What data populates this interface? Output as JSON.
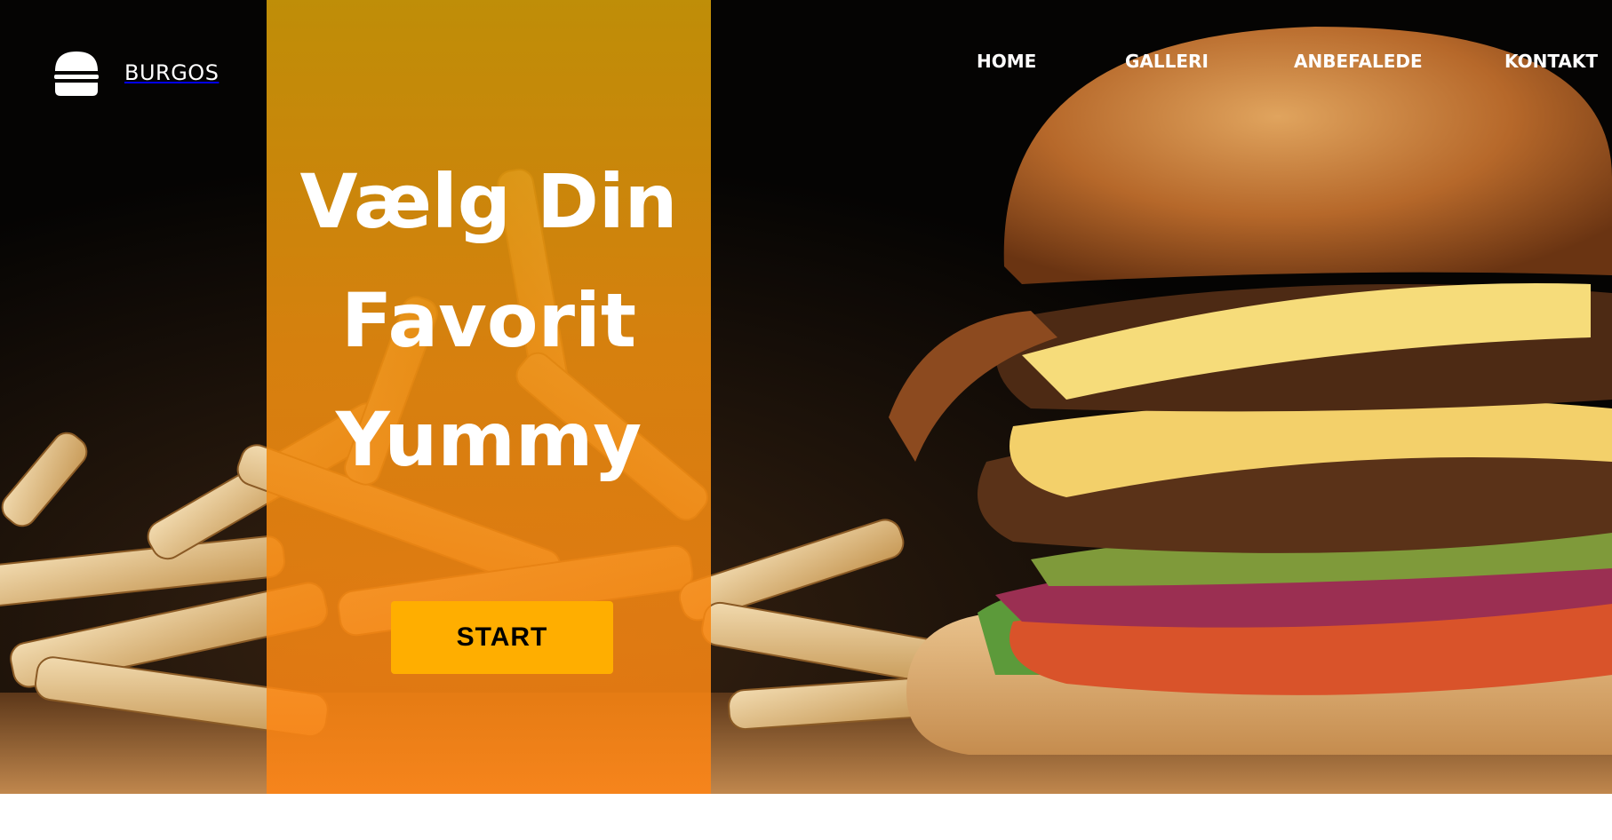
{
  "brand": {
    "name": "BURGOS",
    "icon": "burger-icon"
  },
  "nav": {
    "items": [
      {
        "label": "HOME"
      },
      {
        "label": "GALLERI"
      },
      {
        "label": "ANBEFALEDE"
      },
      {
        "label": "KONTAKT"
      }
    ]
  },
  "hero": {
    "title_lines": [
      "Vælg Din",
      "Favorit",
      "Yummy"
    ],
    "cta_label": "START"
  },
  "colors": {
    "accent": "#ffae00",
    "overlay": "#e8930f",
    "text": "#ffffff"
  }
}
